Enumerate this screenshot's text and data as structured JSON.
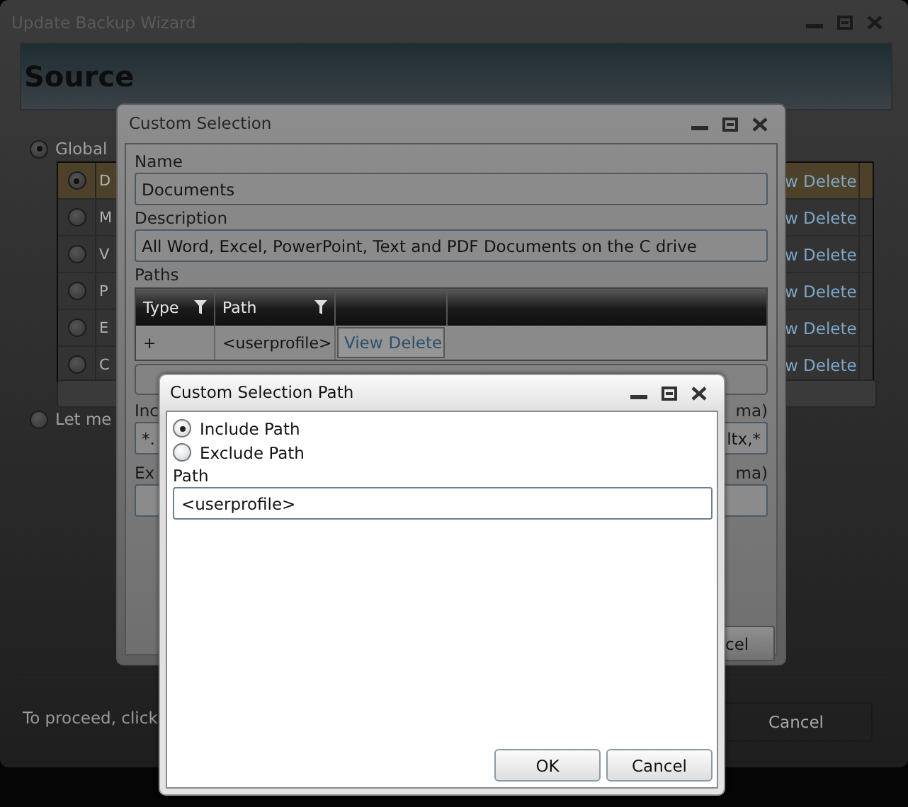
{
  "wizard": {
    "title": "Update Backup Wizard",
    "heading": "Source",
    "options": [
      {
        "label": "Global",
        "selected": true
      },
      {
        "label": "Let me",
        "selected": false
      }
    ],
    "grid_rows": [
      {
        "column_2": "D",
        "column_3": "w Delete",
        "selected": true
      },
      {
        "column_2": "M",
        "column_3": "w Delete",
        "selected": false
      },
      {
        "column_2": "V",
        "column_3": "w Delete",
        "selected": false
      },
      {
        "column_2": "P",
        "column_3": "w Delete",
        "selected": false
      },
      {
        "column_2": "E",
        "column_3": "w Delete",
        "selected": false
      },
      {
        "column_2": "C",
        "column_3": "w Delete",
        "selected": false
      }
    ],
    "footer_text": "To proceed, click",
    "buttons": [
      "Cancel"
    ]
  },
  "custom_selection": {
    "title": "Custom Selection",
    "name_label": "Name",
    "name_value": "Documents",
    "description_label": "Description",
    "description_value": "All Word, Excel, PowerPoint, Text and PDF Documents on the C drive",
    "paths_label": "Paths",
    "paths_columns": [
      {
        "label": "Type"
      },
      {
        "label": "Path"
      }
    ],
    "paths_rows": [
      {
        "type": "+",
        "path": "<userprofile>",
        "actions": [
          "View",
          "Delete"
        ]
      }
    ],
    "include_label_start": "Inc",
    "include_label_end": "ma)",
    "include_value_start": "*.",
    "include_value_end": "ltx,*",
    "exclude_label_start": "Ex",
    "exclude_label_end": "ma)",
    "cancel_button": "cel"
  },
  "path_dialog": {
    "title": "Custom Selection Path",
    "options": [
      {
        "label": "Include Path",
        "selected": true
      },
      {
        "label": "Exclude Path",
        "selected": false
      }
    ],
    "path_label": "Path",
    "path_value": "<userprofile>",
    "buttons": [
      "OK",
      "Cancel"
    ]
  }
}
